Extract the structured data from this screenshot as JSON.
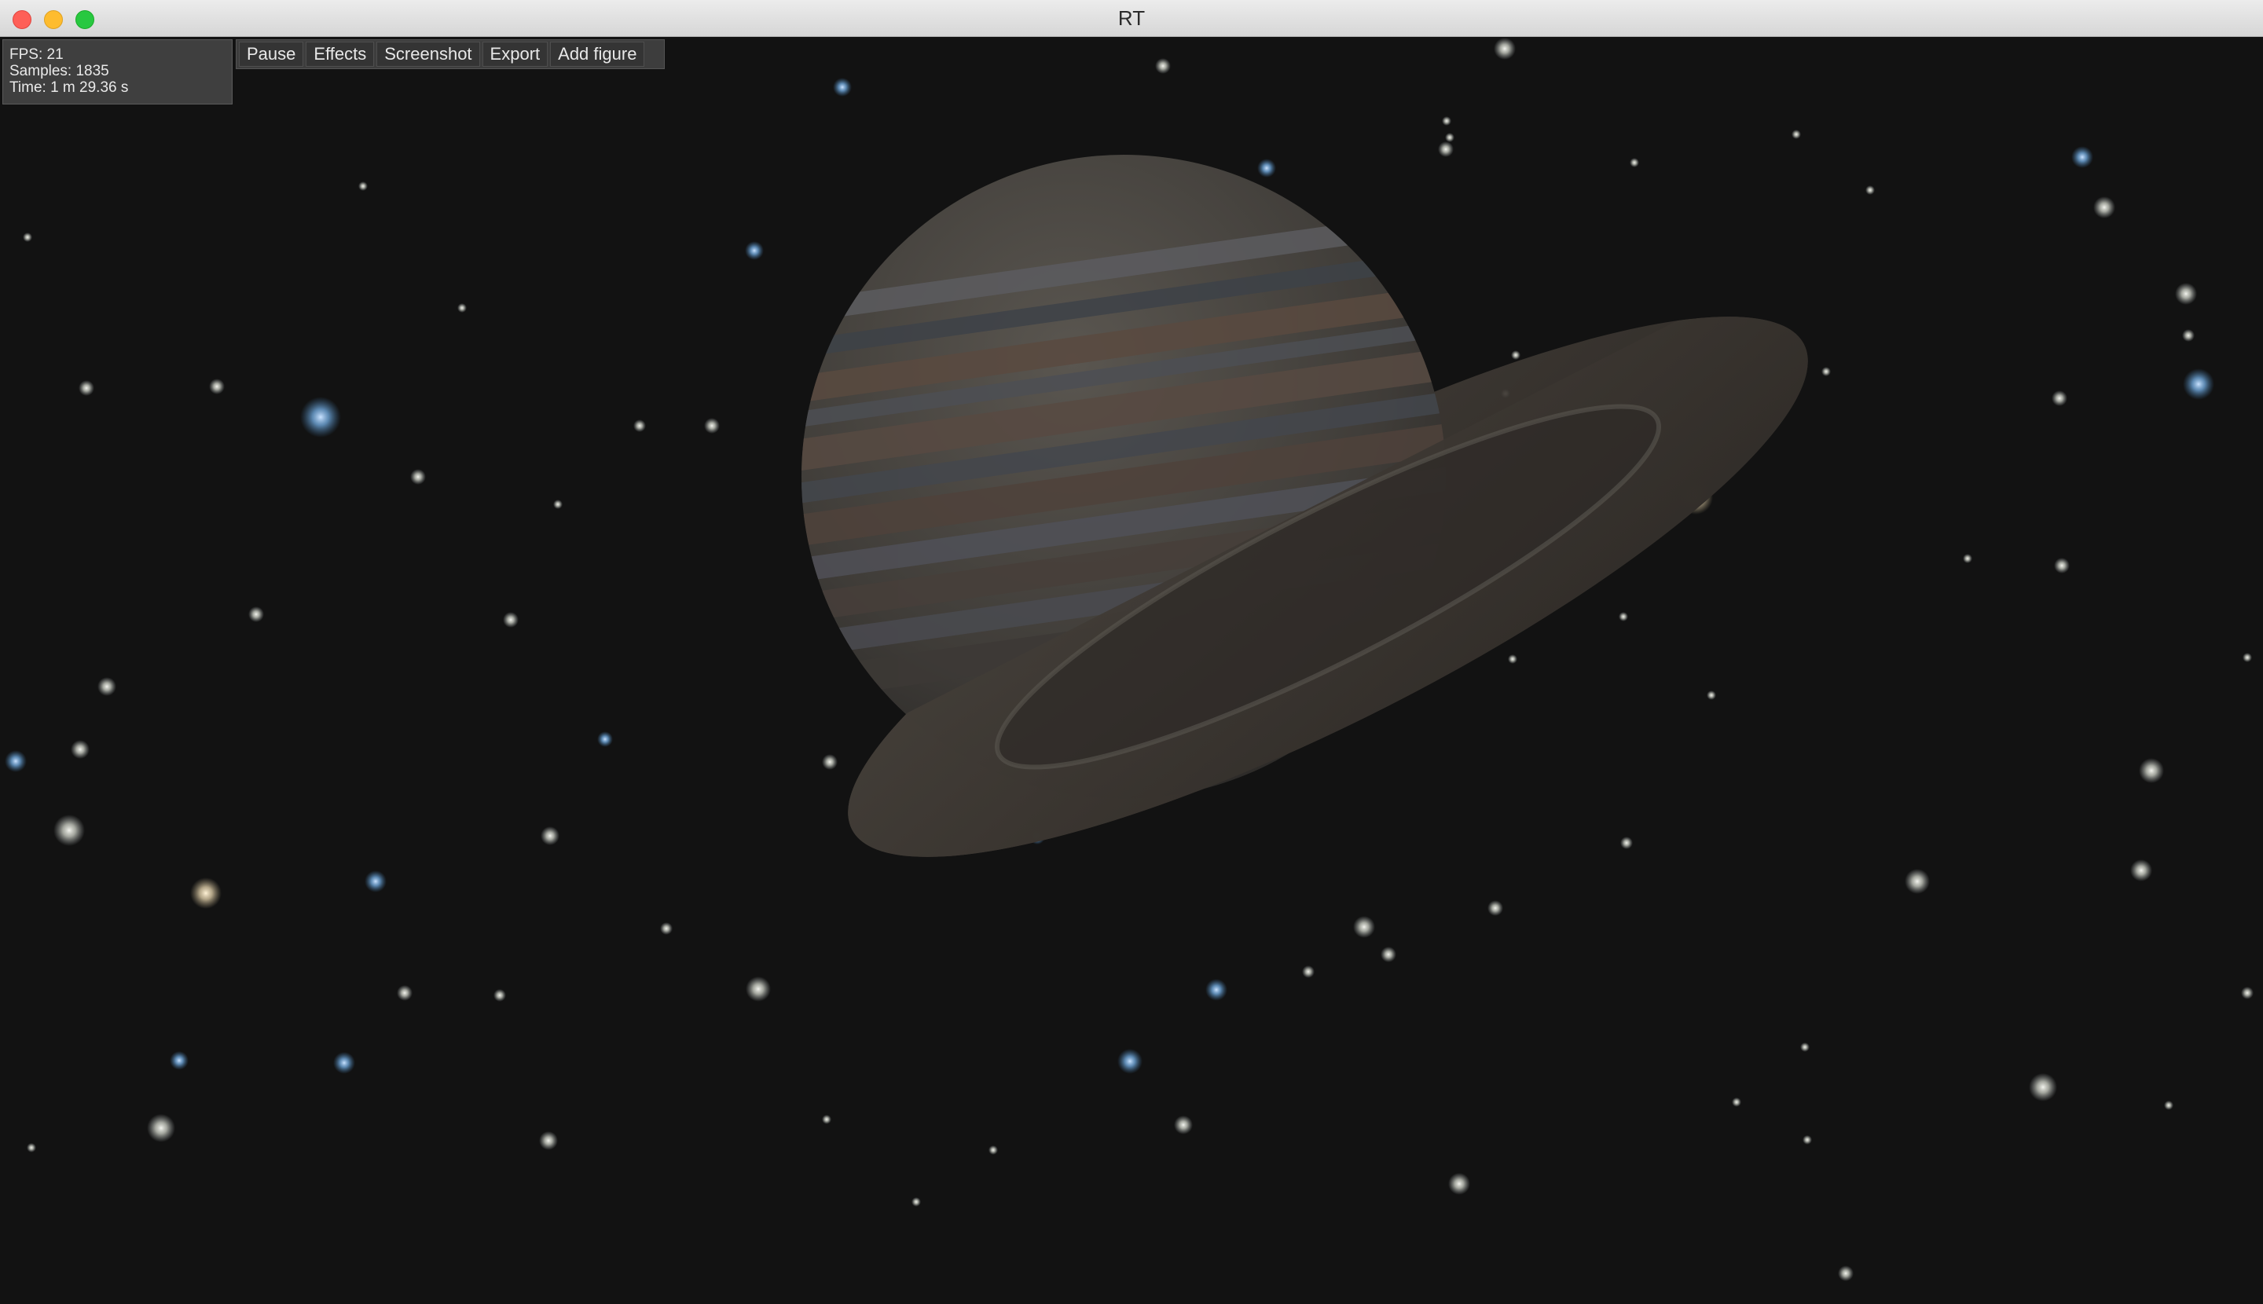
{
  "window": {
    "title": "RT"
  },
  "stats": {
    "fps": "FPS: 21",
    "samples": "Samples: 1835",
    "time": "Time: 1 m 29.36 s"
  },
  "toolbar": {
    "pause": "Pause",
    "effects": "Effects",
    "screenshot": "Screenshot",
    "export": "Export",
    "add_figure": "Add figure"
  },
  "scene": {
    "background_color": "#121212",
    "planet_color": "#4a4540",
    "ring_color": "#3a3530",
    "star_color": "#d8dccf",
    "blue_star_color": "#7fb4e8"
  }
}
